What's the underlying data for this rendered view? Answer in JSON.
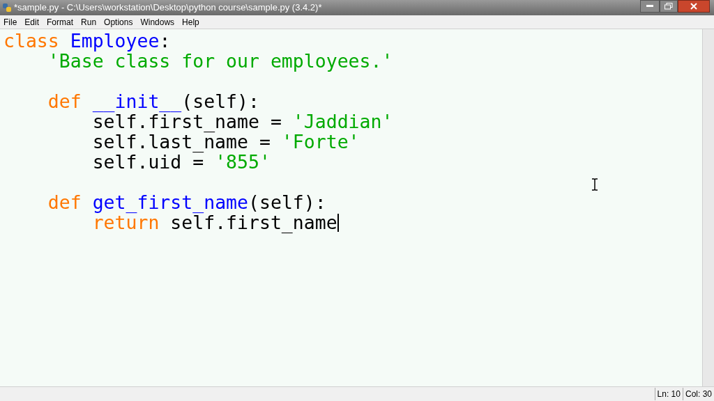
{
  "window": {
    "title": "*sample.py - C:\\Users\\workstation\\Desktop\\python course\\sample.py (3.4.2)*"
  },
  "menu": [
    "File",
    "Edit",
    "Format",
    "Run",
    "Options",
    "Windows",
    "Help"
  ],
  "editor": {
    "lines": [
      {
        "tokens": [
          {
            "kind": "keyword",
            "text": "class"
          },
          {
            "kind": "definition",
            "text": "Employee"
          },
          {
            "kind": "plain",
            "text": ":"
          }
        ],
        "children": [
          {
            "tokens": [
              {
                "kind": "string",
                "text": "'Base class for our employees.'"
              }
            ]
          },
          {
            "kind": "blank"
          },
          {
            "tokens": [
              {
                "kind": "keyword",
                "text": "def"
              },
              {
                "kind": "definition",
                "text": "__init__"
              },
              {
                "kind": "plain",
                "text": "(self):"
              }
            ],
            "children": [
              {
                "tokens": [
                  {
                    "kind": "plain",
                    "text": "self.first_name = "
                  },
                  {
                    "kind": "string",
                    "text": "'Jaddian'"
                  }
                ]
              },
              {
                "tokens": [
                  {
                    "kind": "plain",
                    "text": "self.last_name = "
                  },
                  {
                    "kind": "string",
                    "text": "'Forte'"
                  }
                ]
              },
              {
                "tokens": [
                  {
                    "kind": "plain",
                    "text": "self.uid = "
                  },
                  {
                    "kind": "string",
                    "text": "'855'"
                  }
                ]
              }
            ]
          },
          {
            "kind": "blank"
          },
          {
            "tokens": [
              {
                "kind": "keyword",
                "text": "def"
              },
              {
                "kind": "definition",
                "text": "get_first_name"
              },
              {
                "kind": "plain",
                "text": "(self):"
              }
            ],
            "children": [
              {
                "tokens": [
                  {
                    "kind": "keyword",
                    "text": "return"
                  },
                  {
                    "kind": "plain",
                    "text": "self.first_name"
                  }
                ],
                "cursor": true
              }
            ]
          }
        ]
      }
    ]
  },
  "status_bar": {
    "line": "Ln: 10",
    "column": "Col: 30"
  }
}
